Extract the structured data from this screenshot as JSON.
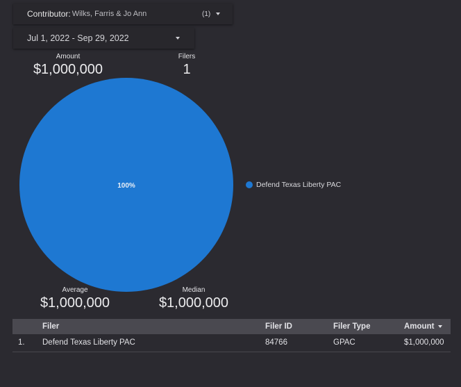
{
  "filters": {
    "contributor": {
      "label": "Contributor:",
      "value": "Wilks, Farris & Jo Ann",
      "count": "(1)"
    },
    "date_range": {
      "value": "Jul 1, 2022 - Sep 29, 2022"
    }
  },
  "kpis": {
    "amount": {
      "title": "Amount",
      "value": "$1,000,000"
    },
    "filers": {
      "title": "Filers",
      "value": "1"
    },
    "average": {
      "title": "Average",
      "value": "$1,000,000"
    },
    "median": {
      "title": "Median",
      "value": "$1,000,000"
    }
  },
  "chart_data": {
    "type": "pie",
    "categories": [
      "Defend Texas Liberty PAC"
    ],
    "values": [
      100
    ],
    "slice_labels": [
      "100%"
    ],
    "colors": [
      "#1e78d2"
    ],
    "legend": "right"
  },
  "table": {
    "headers": [
      "Filer",
      "Filer ID",
      "Filer Type",
      "Amount"
    ],
    "rows": [
      {
        "index": "1.",
        "filer": "Defend Texas Liberty PAC",
        "filer_id": "84766",
        "filer_type": "GPAC",
        "amount": "$1,000,000"
      }
    ]
  }
}
